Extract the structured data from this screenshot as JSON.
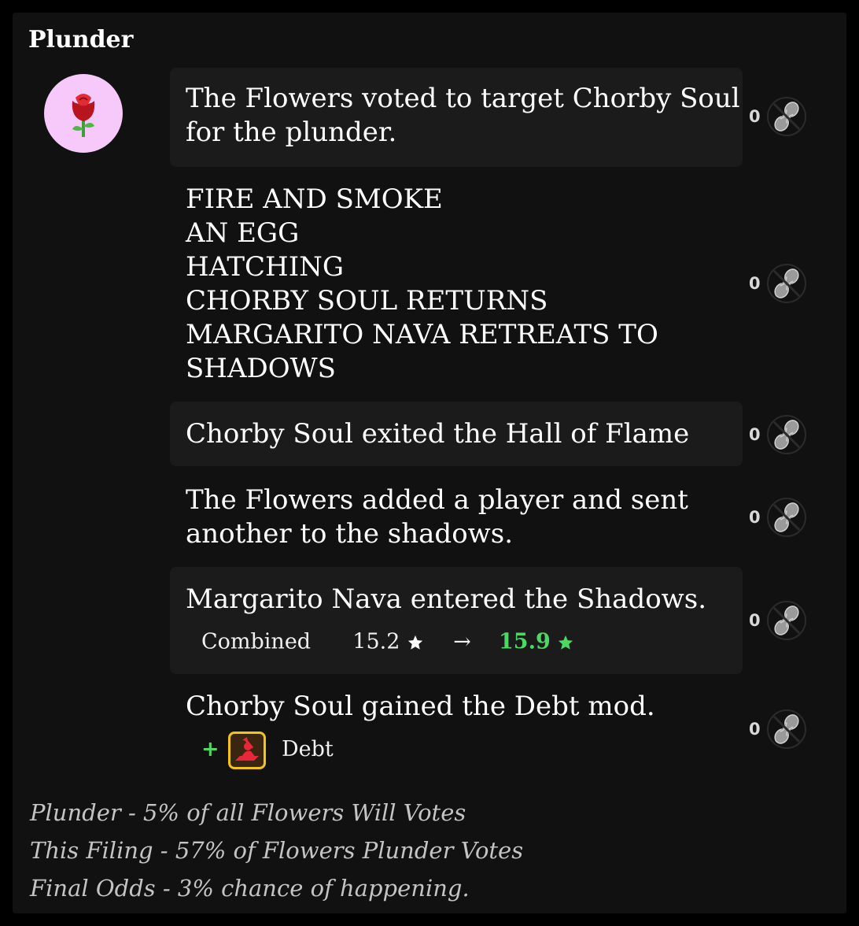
{
  "panel": {
    "title": "Plunder"
  },
  "team": {
    "emoji": "rose",
    "avatar_color": "#f7c9fa"
  },
  "events": [
    {
      "text": "The Flowers voted to target Chorby Soul\nfor the plunder.",
      "votes": "0"
    },
    {
      "text": "FIRE AND SMOKE\nAN EGG\nHATCHING\nCHORBY SOUL RETURNS\nMARGARITO NAVA RETREATS TO\nSHADOWS",
      "votes": "0"
    },
    {
      "text": "Chorby Soul exited the Hall of Flame",
      "votes": "0"
    },
    {
      "text": "The Flowers added a player and sent\nanother to the shadows.",
      "votes": "0"
    },
    {
      "text": "Margarito Nava entered the Shadows.",
      "votes": "0",
      "stat": {
        "label": "Combined",
        "old": "15.2",
        "arrow": "→",
        "new": "15.9"
      }
    },
    {
      "text": "Chorby Soul gained the Debt mod.",
      "votes": "0",
      "mod": {
        "sign": "+",
        "name": "Debt",
        "icon": "debt-icon"
      }
    }
  ],
  "footer": [
    "Plunder - 5% of all Flowers Will Votes",
    "This Filing - 57% of Flowers Plunder Votes",
    "Final Odds - 3% chance of happening."
  ],
  "colors": {
    "positive": "#4bd964",
    "mod_border": "#f0c419",
    "background": "#111111"
  }
}
